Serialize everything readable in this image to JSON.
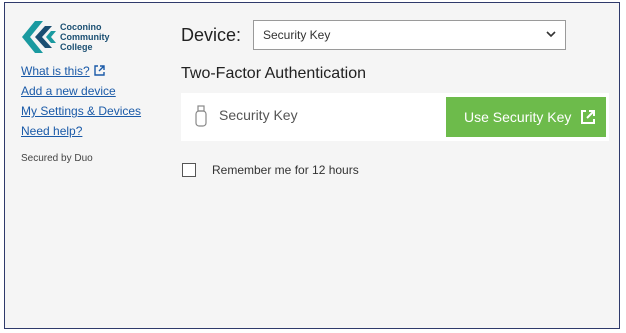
{
  "sidebar": {
    "logo": {
      "line1": "Coconino",
      "line2": "Community",
      "line3": "College",
      "icon": "ccc-chevron-logo"
    },
    "links": [
      {
        "label": "What is this?",
        "icon": "external-link-icon"
      },
      {
        "label": "Add a new device"
      },
      {
        "label": "My Settings & Devices"
      },
      {
        "label": "Need help?"
      }
    ],
    "secured_text": "Secured by Duo"
  },
  "main": {
    "device_label": "Device:",
    "device_select_value": "Security Key",
    "heading": "Two-Factor Authentication",
    "method": {
      "label": "Security Key",
      "icon": "usb-key-icon",
      "button_label": "Use Security Key",
      "button_icon": "external-link-icon"
    },
    "remember_label": "Remember me for 12 hours",
    "remember_checked": false
  },
  "colors": {
    "frame_border": "#2f3a6b",
    "background": "#f5f5f5",
    "link": "#1a5aa8",
    "button": "#6dbb4b",
    "logo_teal": "#1a9aa0",
    "logo_navy": "#1b4f72"
  }
}
